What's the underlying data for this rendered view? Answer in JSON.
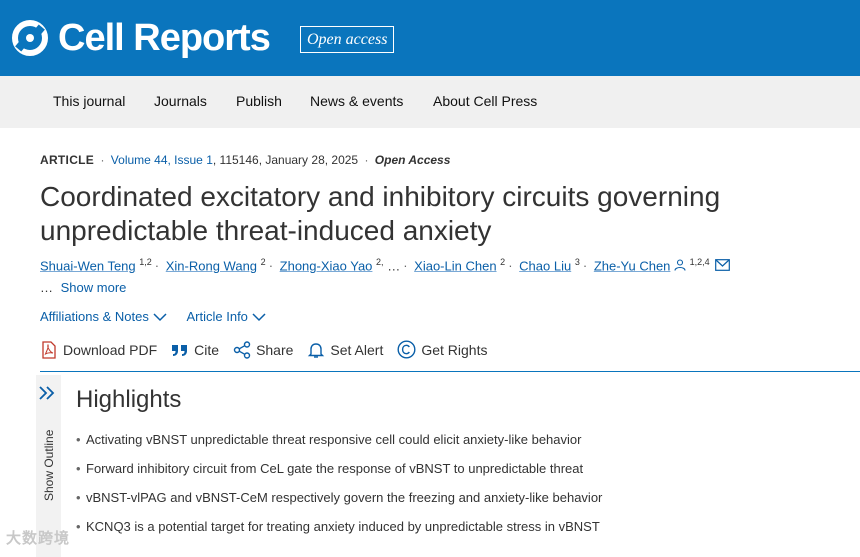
{
  "header": {
    "logo_text": "Cell Reports",
    "badge": "Open access",
    "brand_color": "#0a75bd"
  },
  "nav": {
    "items": [
      "This journal",
      "Journals",
      "Publish",
      "News & events",
      "About Cell Press"
    ]
  },
  "article": {
    "type": "ARTICLE",
    "volume_issue": "Volume 44, Issue 1",
    "article_no": ", 115146, January 28, 2025",
    "access": "Open Access",
    "title": "Coordinated excitatory and inhibitory circuits governing unpredictable threat-induced anxiety"
  },
  "authors": [
    {
      "name": "Shuai-Wen Teng",
      "sup": "1,2"
    },
    {
      "name": "Xin-Rong Wang",
      "sup": "2"
    },
    {
      "name": "Zhong-Xiao Yao",
      "sup": "2,"
    },
    {
      "name": "Xiao-Lin Chen",
      "sup": "2"
    },
    {
      "name": "Chao Liu",
      "sup": "3"
    },
    {
      "name": "Zhe-Yu Chen",
      "sup": "1,2,4"
    }
  ],
  "authors_ellipsis": "…",
  "show_more": "Show more",
  "info_links": {
    "affiliations": "Affiliations & Notes",
    "article_info": "Article Info"
  },
  "toolbar": {
    "download": "Download PDF",
    "cite": "Cite",
    "share": "Share",
    "alert": "Set Alert",
    "rights": "Get Rights"
  },
  "outline": {
    "label": "Show Outline"
  },
  "highlights": {
    "heading": "Highlights",
    "items": [
      "Activating vBNST unpredictable threat responsive cell could elicit anxiety-like behavior",
      "Forward inhibitory circuit from CeL gate the response of vBNST to unpredictable threat",
      "vBNST-vlPAG and vBNST-CeM respectively govern the freezing and anxiety-like behavior",
      "KCNQ3 is a potential target for treating anxiety induced by unpredictable stress in vBNST"
    ]
  },
  "watermark": "大数跨境"
}
